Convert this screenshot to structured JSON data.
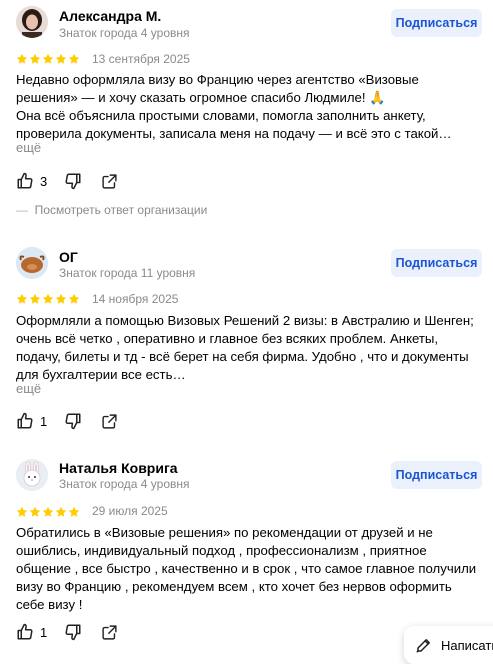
{
  "reviews": [
    {
      "author": "Александра М.",
      "level": "Знаток города 4 уровня",
      "subscribe_label": "Подписаться",
      "rating": 5,
      "date": "13 сентября 2025",
      "text_lines": [
        "Недавно оформляла визу во Францию через агентство «Визовые",
        "решения» — и хочу сказать огромное спасибо Людмиле! 🙏",
        "Она всё объяснила простыми словами, помогла заполнить анкету,",
        "проверила документы, записала меня на подачу — и всё это с такой…"
      ],
      "more_label": "ещё",
      "likes": "3",
      "org_reply_label": "Посмотреть ответ организации"
    },
    {
      "author": "ОГ",
      "level": "Знаток города 11 уровня",
      "subscribe_label": "Подписаться",
      "rating": 5,
      "date": "14 ноября 2025",
      "text_lines": [
        "Оформляли а помощью Визовых Решений 2 визы: в Австралию и Шенген;",
        "очень всё четко , оперативно и главное без всяких проблем. Анкеты,",
        "подачу, билеты и тд - всё берет на себя фирма. Удобно , что и документы",
        "для бухгалтерии все есть…"
      ],
      "more_label": "ещё",
      "likes": "1"
    },
    {
      "author": "Наталья Коврига",
      "level": "Знаток города 4 уровня",
      "subscribe_label": "Подписаться",
      "rating": 5,
      "date": "29 июля 2025",
      "text_lines": [
        "Обратились в «Визовые решения» по рекомендации от друзей и не",
        "ошиблись, индивидуальный подход , профессионализм , приятное",
        "общение , все быстро , качественно и в срок , что самое главное получили",
        "визу во Францию , рекомендуем всем , кто хочет без нервов оформить",
        "себе визу !"
      ],
      "likes": "1"
    }
  ],
  "write_button_label": "Написать",
  "colors": {
    "star": "#fc0",
    "accent": "#1a55d2",
    "subscribe_bg": "#eaf1fd",
    "muted": "#8a8a8a"
  },
  "icons": [
    "like-icon",
    "dislike-icon",
    "share-icon",
    "pencil-icon"
  ]
}
